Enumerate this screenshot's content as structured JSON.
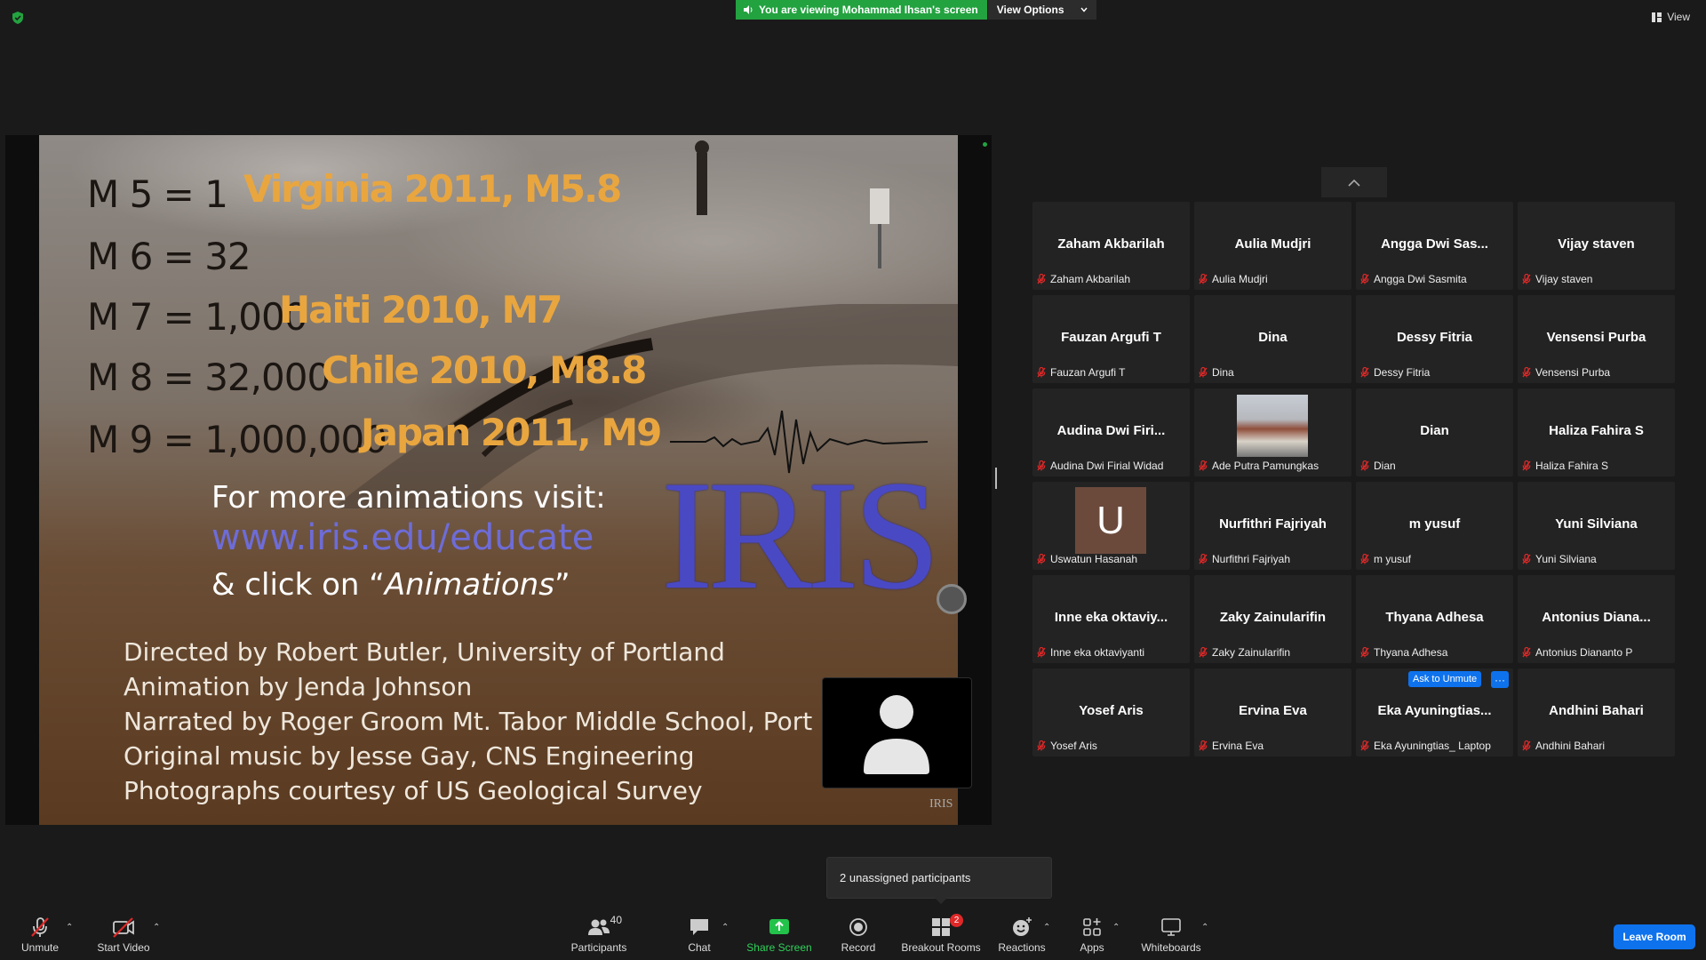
{
  "top": {
    "banner_text": "You are viewing Mohammad Ihsan's screen",
    "view_options": "View Options",
    "view_label": "View"
  },
  "slide": {
    "magnitudes": [
      {
        "eq": "M 5 = 1",
        "loc": "Virginia 2011, M5.8"
      },
      {
        "eq": "M 6 = 32",
        "loc": ""
      },
      {
        "eq": "M 7 = 1,000",
        "loc": "Haiti 2010, M7"
      },
      {
        "eq": "M 8 = 32,000",
        "loc": "Chile 2010, M8.8"
      },
      {
        "eq": "M 9 = 1,000,000",
        "loc": "Japan 2011, M9"
      }
    ],
    "visit_line1": "For more animations visit:",
    "visit_url": "www.iris.edu/educate",
    "visit_line3_prefix": "& click on “",
    "visit_line3_em": "Animations",
    "visit_line3_suffix": "”",
    "logo_text": "IRIS",
    "credits": [
      "Directed by Robert Butler, University of Portland",
      "Animation by Jenda Johnson",
      "Narrated by Roger Groom Mt. Tabor Middle School, Port",
      "Original music by Jesse Gay, CNS Engineering",
      "Photographs courtesy of US Geological Survey"
    ],
    "corner_mark": "IRIS"
  },
  "participants": [
    {
      "display": "Zaham Akbarilah",
      "name": "Zaham Akbarilah"
    },
    {
      "display": "Aulia Mudjri",
      "name": "Aulia Mudjri"
    },
    {
      "display": "Angga Dwi Sas...",
      "name": "Angga Dwi Sasmita"
    },
    {
      "display": "Vijay staven",
      "name": "Vijay staven"
    },
    {
      "display": "Fauzan Argufi T",
      "name": "Fauzan Argufi T"
    },
    {
      "display": "Dina",
      "name": "Dina"
    },
    {
      "display": "Dessy Fitria",
      "name": "Dessy Fitria"
    },
    {
      "display": "Vensensi Purba",
      "name": "Vensensi Purba"
    },
    {
      "display": "Audina Dwi Firi...",
      "name": "Audina Dwi Firial Widad"
    },
    {
      "display": "",
      "name": "Ade Putra Pamungkas"
    },
    {
      "display": "Dian",
      "name": "Dian"
    },
    {
      "display": "Haliza Fahira S",
      "name": "Haliza Fahira S"
    },
    {
      "display": "",
      "name": "Uswatun Hasanah",
      "avatar_letter": "U"
    },
    {
      "display": "Nurfithri Fajriyah",
      "name": "Nurfithri Fajriyah"
    },
    {
      "display": "m yusuf",
      "name": "m yusuf"
    },
    {
      "display": "Yuni Silviana",
      "name": "Yuni Silviana"
    },
    {
      "display": "Inne eka oktaviy...",
      "name": "Inne eka oktaviyanti"
    },
    {
      "display": "Zaky Zainularifin",
      "name": "Zaky Zainularifin"
    },
    {
      "display": "Thyana Adhesa",
      "name": "Thyana Adhesa"
    },
    {
      "display": "Antonius Diana...",
      "name": "Antonius Diananto P"
    },
    {
      "display": "Yosef Aris",
      "name": "Yosef Aris"
    },
    {
      "display": "Ervina Eva",
      "name": "Ervina Eva"
    },
    {
      "display": "Eka Ayuningtias...",
      "name": "Eka Ayuningtias_ Laptop"
    },
    {
      "display": "Andhini Bahari",
      "name": "Andhini Bahari"
    }
  ],
  "tile_actions": {
    "ask_to_unmute": "Ask to Unmute",
    "more": "···"
  },
  "toast": {
    "text": "2 unassigned participants"
  },
  "toolbar": {
    "unmute": "Unmute",
    "start_video": "Start Video",
    "participants": "Participants",
    "participants_count": "40",
    "chat": "Chat",
    "share_screen": "Share Screen",
    "record": "Record",
    "breakout_rooms": "Breakout Rooms",
    "breakout_badge": "2",
    "reactions": "Reactions",
    "apps": "Apps",
    "whiteboards": "Whiteboards",
    "leave": "Leave Room"
  },
  "colors": {
    "accent_blue": "#0e72ed",
    "share_green": "#23a240",
    "danger_red": "#e02828",
    "background": "#1a1a1a"
  }
}
